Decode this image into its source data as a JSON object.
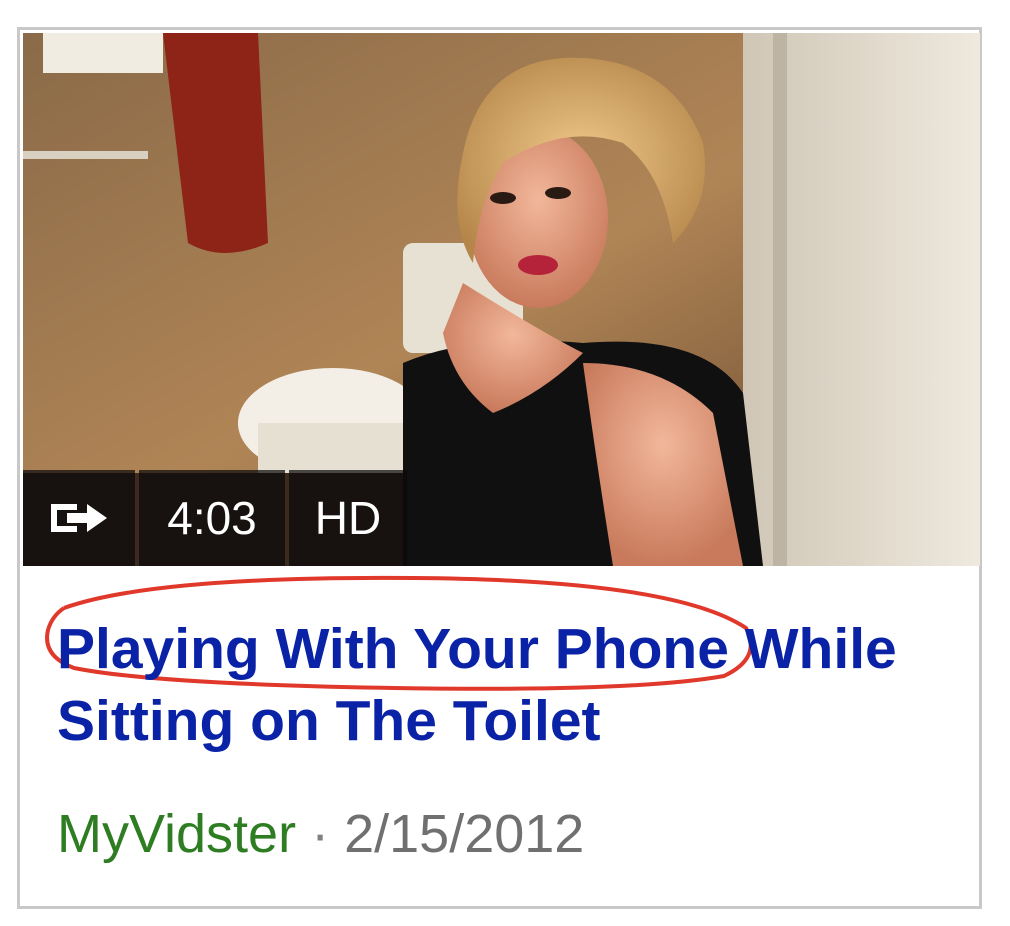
{
  "video_card": {
    "thumbnail": {
      "alt_subject": "person-in-bathroom-thumbnail",
      "share_icon": "share-arrow-icon",
      "duration": "4:03",
      "quality_badge": "HD"
    },
    "title": "Playing With Your Phone While Sitting on The Toilet",
    "source": "MyVidster",
    "separator": "·",
    "date": "2/15/2012",
    "annotation": {
      "type": "red-ellipse",
      "circled_text": "Playing With Your Phone",
      "color": "#e0392b"
    }
  },
  "colors": {
    "title_link": "#0a22a6",
    "source": "#2e7d22",
    "date": "#707070",
    "card_border": "#c8c8c8"
  }
}
